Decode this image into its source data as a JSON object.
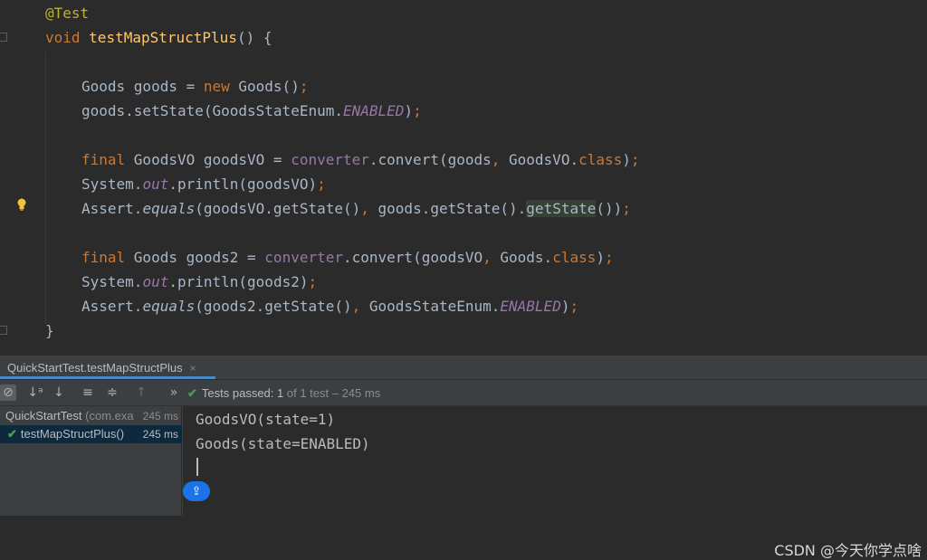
{
  "editor": {
    "lines": [
      [
        {
          "t": "@Test",
          "c": "t-ann"
        }
      ],
      [
        {
          "t": "void ",
          "c": "t-kw"
        },
        {
          "t": "testMapStructPlus",
          "c": "t-fn"
        },
        {
          "t": "() {",
          "c": ""
        }
      ],
      [],
      [
        {
          "t": "Goods goods = ",
          "c": ""
        },
        {
          "t": "new ",
          "c": "t-kw"
        },
        {
          "t": "Goods()",
          "c": ""
        },
        {
          "t": ";",
          "c": "t-kw"
        }
      ],
      [
        {
          "t": "goods.setState(GoodsStateEnum.",
          "c": ""
        },
        {
          "t": "ENABLED",
          "c": "t-static"
        },
        {
          "t": ")",
          "c": ""
        },
        {
          "t": ";",
          "c": "t-kw"
        }
      ],
      [],
      [
        {
          "t": "final ",
          "c": "t-kw"
        },
        {
          "t": "GoodsVO goodsVO = ",
          "c": ""
        },
        {
          "t": "converter",
          "c": "t-field"
        },
        {
          "t": ".convert(goods",
          "c": ""
        },
        {
          "t": ", ",
          "c": "t-kw"
        },
        {
          "t": "GoodsVO.",
          "c": ""
        },
        {
          "t": "class",
          "c": "t-kw"
        },
        {
          "t": ")",
          "c": ""
        },
        {
          "t": ";",
          "c": "t-kw"
        }
      ],
      [
        {
          "t": "System.",
          "c": ""
        },
        {
          "t": "out",
          "c": "t-static"
        },
        {
          "t": ".println(goodsVO)",
          "c": ""
        },
        {
          "t": ";",
          "c": "t-kw"
        }
      ],
      [
        {
          "t": "Assert.",
          "c": ""
        },
        {
          "t": "equals",
          "c": "t-sm"
        },
        {
          "t": "(goodsVO.getState()",
          "c": ""
        },
        {
          "t": ", ",
          "c": "t-kw"
        },
        {
          "t": "goods.getState().",
          "c": ""
        },
        {
          "t": "getState",
          "c": "hl"
        },
        {
          "t": "())",
          "c": ""
        },
        {
          "t": ";",
          "c": "t-kw"
        }
      ],
      [],
      [
        {
          "t": "final ",
          "c": "t-kw"
        },
        {
          "t": "Goods goods2 = ",
          "c": ""
        },
        {
          "t": "converter",
          "c": "t-field"
        },
        {
          "t": ".convert(goodsVO",
          "c": ""
        },
        {
          "t": ", ",
          "c": "t-kw"
        },
        {
          "t": "Goods.",
          "c": ""
        },
        {
          "t": "class",
          "c": "t-kw"
        },
        {
          "t": ")",
          "c": ""
        },
        {
          "t": ";",
          "c": "t-kw"
        }
      ],
      [
        {
          "t": "System.",
          "c": ""
        },
        {
          "t": "out",
          "c": "t-static"
        },
        {
          "t": ".println(goods2)",
          "c": ""
        },
        {
          "t": ";",
          "c": "t-kw"
        }
      ],
      [
        {
          "t": "Assert.",
          "c": ""
        },
        {
          "t": "equals",
          "c": "t-sm"
        },
        {
          "t": "(goods2.getState()",
          "c": ""
        },
        {
          "t": ", ",
          "c": "t-kw"
        },
        {
          "t": "GoodsStateEnum.",
          "c": ""
        },
        {
          "t": "ENABLED",
          "c": "t-static"
        },
        {
          "t": ")",
          "c": ""
        },
        {
          "t": ";",
          "c": "t-kw"
        }
      ],
      [
        {
          "t": "}",
          "c": ""
        }
      ]
    ]
  },
  "run_panel": {
    "tab_label": "QuickStartTest.testMapStructPlus",
    "tab_close": "×",
    "status": {
      "check": "✔",
      "passed": "Tests passed: ",
      "count": "1",
      "rest": " of 1 test – 245 ms"
    },
    "tree": {
      "root_label": "QuickStartTest",
      "root_pkg": " (com.exa",
      "root_time": "245 ms",
      "child_check": "✔",
      "child_label": "testMapStructPlus()",
      "child_time": "245 ms"
    },
    "console": {
      "lines": [
        "GoodsVO(state=1)",
        "Goods(state=ENABLED)"
      ]
    }
  },
  "watermark": "CSDN @今天你学点啥",
  "icons": {
    "stop": "⊘",
    "sort_alpha": "↓ᵃ",
    "sort_duration": "↓",
    "expand_all": "≡",
    "collapse_all": "≑",
    "prev_failed": "↑",
    "more": "»",
    "scroll_to_end": "⇪"
  },
  "colors": {
    "editor_bg": "#2b2b2b",
    "panel_bg": "#3c3f41",
    "keyword": "#cc7832",
    "function": "#ffc66d",
    "field": "#9876aa",
    "annotation": "#bbb529",
    "pass_green": "#499c54",
    "accent_blue": "#4a88c7"
  }
}
